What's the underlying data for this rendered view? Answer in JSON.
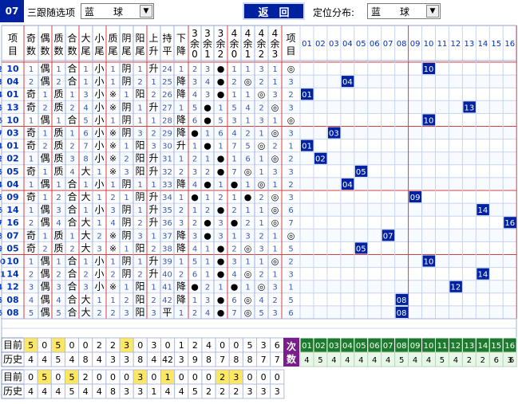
{
  "header": {
    "period": "07",
    "left_label": "三跟随选项",
    "left_select": "蓝　　球",
    "back": "返　回",
    "right_label": "定位分布:",
    "right_select": "蓝　　球"
  },
  "left_headers": [
    "项目",
    "奇数",
    "偶数",
    "质数",
    "合数",
    "大尾",
    "小尾",
    "质尾",
    "阴尾",
    "阳尾",
    "上升",
    "持平",
    "下降",
    "3余0",
    "3余1",
    "3余2",
    "4余0",
    "4余1",
    "4余2",
    "4余3",
    "项目"
  ],
  "right_headers": [
    "01",
    "02",
    "03",
    "04",
    "05",
    "06",
    "07",
    "08",
    "09",
    "10",
    "11",
    "12",
    "13",
    "14",
    "15",
    "16"
  ],
  "rows": [
    {
      "n": "10",
      "c": [
        "1",
        "偶",
        "1",
        "合",
        "1",
        "小",
        "1",
        "阴",
        "1",
        "升",
        "24",
        "1",
        "2",
        "3",
        "●",
        "1",
        "1",
        "3",
        "1",
        "◎",
        "2"
      ]
    },
    {
      "n": "04",
      "c": [
        "2",
        "偶",
        "2",
        "合",
        "1",
        "小",
        "1",
        "阴",
        "2",
        "1",
        "25",
        "降",
        "3",
        "4",
        "●",
        "2",
        "◎",
        "2",
        "1",
        "3",
        "3"
      ]
    },
    {
      "n": "01",
      "c": [
        "奇",
        "1",
        "质",
        "1",
        "3",
        "小",
        "※",
        "1",
        "阳",
        "2",
        "26",
        "降",
        "4",
        "3",
        "●",
        "1",
        "1",
        "◎",
        "3",
        "2",
        "4"
      ]
    },
    {
      "n": "13",
      "c": [
        "奇",
        "2",
        "质",
        "2",
        "4",
        "小",
        "※",
        "阴",
        "1",
        "升",
        "27",
        "1",
        "5",
        "●",
        "1",
        "5",
        "4",
        "2",
        "◎",
        "3",
        "5"
      ]
    },
    {
      "n": "10",
      "c": [
        "1",
        "偶",
        "1",
        "合",
        "5",
        "小",
        "1",
        "阴",
        "1",
        "1",
        "28",
        "降",
        "6",
        "●",
        "5",
        "3",
        "1",
        "3",
        "1",
        "◎",
        "6"
      ]
    },
    {
      "n": "03",
      "c": [
        "奇",
        "1",
        "质",
        "1",
        "6",
        "小",
        "※",
        "阴",
        "3",
        "2",
        "29",
        "降",
        "●",
        "1",
        "6",
        "4",
        "2",
        "1",
        "◎",
        "3",
        "7"
      ]
    },
    {
      "n": "01",
      "c": [
        "奇",
        "2",
        "质",
        "2",
        "7",
        "小",
        "※",
        "1",
        "阳",
        "3",
        "30",
        "升",
        "1",
        "●",
        "1",
        "7",
        "5",
        "◎",
        "2",
        "1",
        "4"
      ]
    },
    {
      "n": "02",
      "c": [
        "1",
        "偶",
        "质",
        "3",
        "8",
        "小",
        "※",
        "2",
        "阳",
        "升",
        "31",
        "1",
        "2",
        "1",
        "●",
        "1",
        "6",
        "1",
        "◎",
        "2",
        "2"
      ]
    },
    {
      "n": "05",
      "c": [
        "奇",
        "1",
        "质",
        "4",
        "大",
        "1",
        "※",
        "3",
        "阳",
        "升",
        "32",
        "2",
        "3",
        "2",
        "●",
        "7",
        "◎",
        "1",
        "3",
        "3",
        "5"
      ]
    },
    {
      "n": "04",
      "c": [
        "1",
        "偶",
        "1",
        "合",
        "1",
        "小",
        "1",
        "阴",
        "1",
        "1",
        "33",
        "降",
        "4",
        "●",
        "1",
        "●",
        "1",
        "◎",
        "1",
        "2",
        "4"
      ]
    },
    {
      "n": "09",
      "c": [
        "奇",
        "1",
        "2",
        "合",
        "大",
        "1",
        "2",
        "1",
        "阴",
        "升",
        "34",
        "1",
        "●",
        "1",
        "2",
        "1",
        "●",
        "2",
        "◎",
        "3",
        "5"
      ]
    },
    {
      "n": "14",
      "c": [
        "1",
        "偶",
        "3",
        "合",
        "1",
        "小",
        "3",
        "阴",
        "1",
        "升",
        "35",
        "2",
        "1",
        "2",
        "●",
        "2",
        "1",
        "1",
        "◎",
        "6",
        "6"
      ]
    },
    {
      "n": "16",
      "c": [
        "2",
        "偶",
        "4",
        "合",
        "大",
        "1",
        "4",
        "阴",
        "2",
        "升",
        "36",
        "3",
        "2",
        "●",
        "3",
        "●",
        "2",
        "1",
        "◎",
        "7",
        "7"
      ]
    },
    {
      "n": "07",
      "c": [
        "奇",
        "1",
        "质",
        "1",
        "大",
        "2",
        "※",
        "阴",
        "3",
        "1",
        "37",
        "降",
        "3",
        "●",
        "3",
        "1",
        "3",
        "2",
        "1",
        "◎",
        "8"
      ]
    },
    {
      "n": "05",
      "c": [
        "奇",
        "2",
        "质",
        "2",
        "大",
        "3",
        "※",
        "1",
        "阳",
        "2",
        "38",
        "降",
        "4",
        "1",
        "●",
        "2",
        "◎",
        "3",
        "1",
        "5",
        "9"
      ]
    },
    {
      "n": "10",
      "c": [
        "1",
        "偶",
        "1",
        "合",
        "1",
        "小",
        "1",
        "阴",
        "1",
        "升",
        "39",
        "1",
        "5",
        "1",
        "●",
        "3",
        "1",
        "1",
        "◎",
        "2",
        "10"
      ]
    },
    {
      "n": "14",
      "c": [
        "2",
        "偶",
        "2",
        "合",
        "2",
        "小",
        "2",
        "阴",
        "2",
        "升",
        "40",
        "2",
        "6",
        "1",
        "●",
        "4",
        "◎",
        "2",
        "1",
        "3",
        "11"
      ]
    },
    {
      "n": "12",
      "c": [
        "3",
        "偶",
        "3",
        "合",
        "3",
        "小",
        "※",
        "1",
        "阳",
        "1",
        "41",
        "降",
        "●",
        "2",
        "1",
        "●",
        "1",
        "◎",
        "3",
        "1",
        "4"
      ]
    },
    {
      "n": "08",
      "c": [
        "4",
        "偶",
        "4",
        "合",
        "大",
        "1",
        "1",
        "2",
        "阳",
        "2",
        "42",
        "降",
        "1",
        "3",
        "●",
        "6",
        "◎",
        "4",
        "2",
        "5",
        "5"
      ]
    },
    {
      "n": "08",
      "c": [
        "5",
        "偶",
        "5",
        "合",
        "大",
        "2",
        "2",
        "3",
        "阳",
        "3",
        "平",
        "1",
        "2",
        "4",
        "●",
        "7",
        "◎",
        "5",
        "3",
        "6",
        "6"
      ]
    }
  ],
  "dist_positions": [
    10,
    4,
    1,
    13,
    10,
    3,
    1,
    2,
    5,
    4,
    9,
    14,
    16,
    7,
    5,
    10,
    14,
    12,
    8,
    8
  ],
  "footer": {
    "row1_label": "目前",
    "row1": [
      "5",
      "0",
      "5",
      "0",
      "0",
      "2",
      "2",
      "3",
      "0",
      "3",
      "0",
      "1",
      "2",
      "4",
      "0",
      "0",
      "5",
      "3",
      "6"
    ],
    "row2_label": "历史",
    "row2": [
      "4",
      "4",
      "5",
      "4",
      "8",
      "4",
      "3",
      "3",
      "8",
      "4",
      "42",
      "3",
      "9",
      "8",
      "7",
      "8",
      "8",
      "7",
      "7"
    ],
    "count_label": "次数",
    "count_nums": [
      "01",
      "02",
      "03",
      "04",
      "05",
      "06",
      "07",
      "08",
      "09",
      "10",
      "11",
      "12",
      "13",
      "14",
      "15",
      "16"
    ],
    "count_vals": [
      "4",
      "5",
      "4",
      "4",
      "4",
      "4",
      "4",
      "5",
      "4",
      "4",
      "5",
      "4",
      "2",
      "2",
      "6",
      "3",
      "6"
    ],
    "row3_label": "目前",
    "row3": [
      "0",
      "5",
      "0",
      "5",
      "2",
      "0",
      "0",
      "0",
      "3",
      "0",
      "1",
      "0",
      "0",
      "0",
      "2",
      "3",
      "0",
      "0",
      "0"
    ],
    "row4_label": "历史",
    "row4": [
      "4",
      "4",
      "4",
      "5",
      "4",
      "4",
      "8",
      "3",
      "3",
      "1",
      "4",
      "4",
      "5",
      "2",
      "2",
      "2",
      "3",
      "3",
      "3"
    ]
  }
}
